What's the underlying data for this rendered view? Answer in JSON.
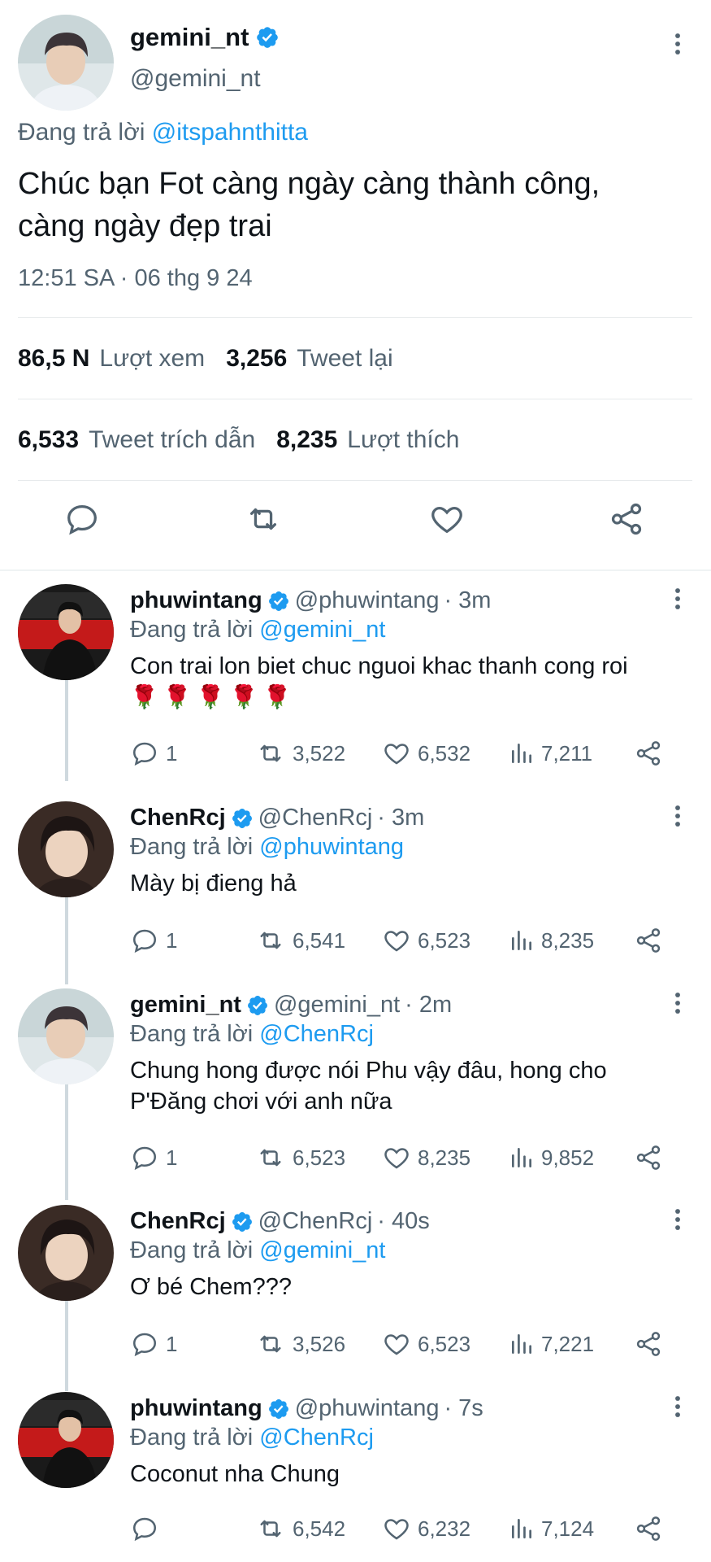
{
  "main_tweet": {
    "name": "gemini_nt",
    "handle": "@gemini_nt",
    "replying_prefix": "Đang trả lời",
    "replying_to": "@itspahnthitta",
    "text_line1": "Chúc bạn Fot càng ngày càng thành công,",
    "text_line2": "càng ngày đẹp trai",
    "timestamp": "12:51 SA · 06 thg 9 24",
    "views_count": "86,5 N",
    "views_label": "Lượt xem",
    "retweets_count": "3,256",
    "retweets_label": "Tweet lại",
    "quotes_count": "6,533",
    "quotes_label": "Tweet trích dẫn",
    "likes_count": "8,235",
    "likes_label": "Lượt thích"
  },
  "replies": [
    {
      "name": "phuwintang",
      "handle": "@phuwintang",
      "time": "· 3m",
      "replying_prefix": "Đang trả lời",
      "replying_to": "@gemini_nt",
      "text": "Con trai lon biet chuc nguoi khac thanh cong roi",
      "emoji": "🌹🌹🌹🌹🌹",
      "replies": "1",
      "retweets": "3,522",
      "likes": "6,532",
      "views": "7,211"
    },
    {
      "name": "ChenRcj",
      "handle": "@ChenRcj",
      "time": "· 3m",
      "replying_prefix": "Đang trả lời",
      "replying_to": "@phuwintang",
      "text": "Mày bị đieng hả",
      "replies": "1",
      "retweets": "6,541",
      "likes": "6,523",
      "views": "8,235"
    },
    {
      "name": "gemini_nt",
      "handle": "@gemini_nt",
      "time": "· 2m",
      "replying_prefix": "Đang trả lời",
      "replying_to": "@ChenRcj",
      "text_line1": "Chung hong được nói Phu vậy đâu, hong cho",
      "text_line2": "P'Đăng chơi với anh nữa",
      "replies": "1",
      "retweets": "6,523",
      "likes": "8,235",
      "views": "9,852"
    },
    {
      "name": "ChenRcj",
      "handle": "@ChenRcj",
      "time": "· 40s",
      "replying_prefix": "Đang trả lời",
      "replying_to": "@gemini_nt",
      "text": "Ơ bé Chem???",
      "replies": "1",
      "retweets": "3,526",
      "likes": "6,523",
      "views": "7,221"
    },
    {
      "name": "phuwintang",
      "handle": "@phuwintang",
      "time": "· 7s",
      "replying_prefix": "Đang trả lời",
      "replying_to": "@ChenRcj",
      "text": "Coconut nha Chung",
      "replies": "",
      "retweets": "6,542",
      "likes": "6,232",
      "views": "7,124"
    }
  ],
  "colors": {
    "accent": "#1d9bf0",
    "muted": "#536471",
    "text": "#0f1419"
  }
}
